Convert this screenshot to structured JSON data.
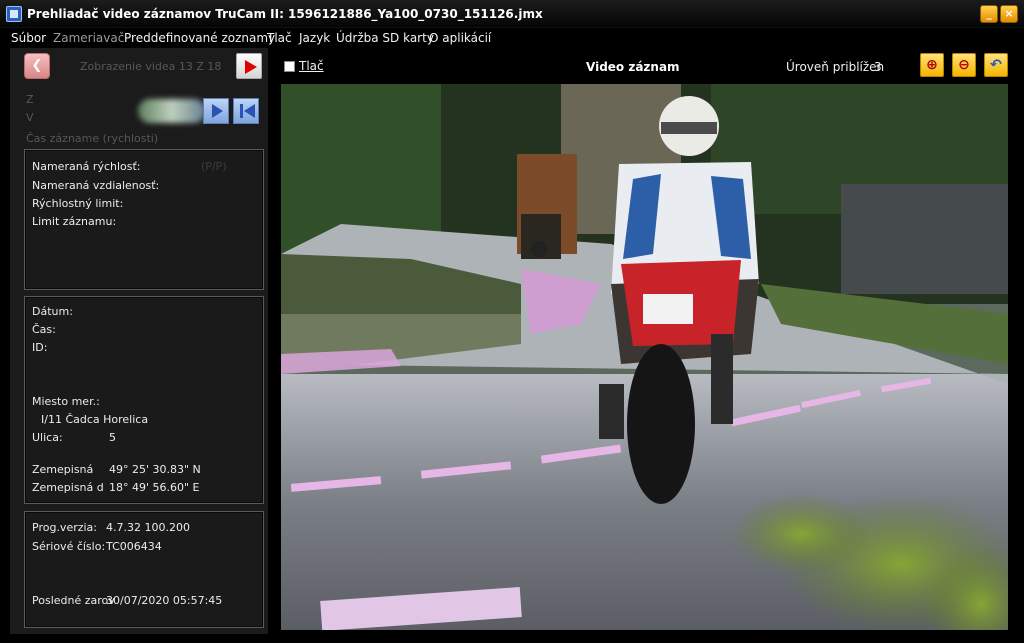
{
  "window": {
    "title": "Prehliadač video záznamov TruCam II:  1596121886_Ya100_0730_151126.jmx",
    "minimize_glyph": "_",
    "close_glyph": "×"
  },
  "menu": [
    "Súbor",
    "Zameriavač",
    "Preddefinované zoznamy",
    "Tlač",
    "Jazyk",
    "Údržba SD karty",
    "O aplikácií"
  ],
  "player": {
    "video_count": "Zobrazenie videa 13 Z 18",
    "faded_labels": [
      "Z",
      "V",
      "Čas zázname (rychlosti)"
    ]
  },
  "measurement": {
    "speed_label": "Nameraná rýchlosť:",
    "speed_value": "(P/P)",
    "distance_label": "Nameraná vzdialenosť:",
    "speed_limit_label": "Rýchlostný limit:",
    "record_limit_label": "Limit záznamu:"
  },
  "record": {
    "date_label": "Dátum:",
    "time_label": "Čas:",
    "id_label": "ID:",
    "location_label": "Miesto mer.:",
    "location_value": "I/11 Čadca Horelica",
    "street_label": "Ulica:",
    "street_value": "5",
    "lat_label": "Zemepisná",
    "lat_value": "49° 25' 30.83\" N",
    "lon_label": "Zemepisná d",
    "lon_value": "18° 49' 56.60\" E"
  },
  "device": {
    "prog_label": "Prog.verzia:",
    "prog_value": "4.7.32  100.200",
    "serial_label": "Sériové číslo:",
    "serial_value": "TC006434",
    "last_label": "Posledné zarov",
    "last_value": "30/07/2020  05:57:45"
  },
  "toolbar": {
    "print_label": "Tlač",
    "video_title": "Video záznam",
    "zoom_label": "Úroveň priblížen",
    "zoom_value": "3"
  },
  "colors": {
    "accent_button": "#f3b400",
    "panel_bg": "#1b1b1b",
    "box_border": "#5a5a5a"
  },
  "icons": [
    "app-icon",
    "minimize-icon",
    "close-icon",
    "back-icon",
    "play-icon",
    "forward-icon",
    "skip-first-icon",
    "zoom-in-icon",
    "zoom-out-icon",
    "undo-icon"
  ]
}
